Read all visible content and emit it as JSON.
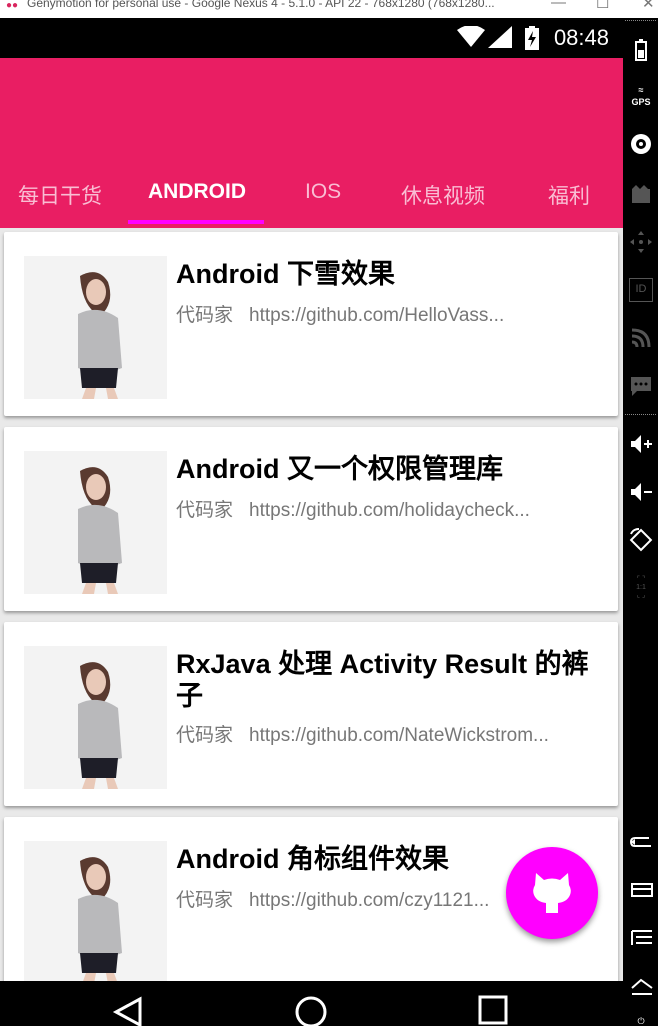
{
  "window": {
    "title": "Genymotion for personal use - Google Nexus 4 - 5.1.0 - API 22 - 768x1280 (768x1280...",
    "minimize": "—",
    "maximize": "☐",
    "close": "✕"
  },
  "status_bar": {
    "time": "08:48"
  },
  "tabs": [
    {
      "label": "每日干货",
      "active": false
    },
    {
      "label": "ANDROID",
      "active": true
    },
    {
      "label": "IOS",
      "active": false
    },
    {
      "label": "休息视频",
      "active": false
    },
    {
      "label": "福利",
      "active": false
    }
  ],
  "articles": [
    {
      "title": "Android 下雪效果",
      "author": "代码家",
      "url": "https://github.com/HelloVass..."
    },
    {
      "title": "Android 又一个权限管理库",
      "author": "代码家",
      "url": "https://github.com/holidaycheck..."
    },
    {
      "title": "RxJava 处理 Activity Result 的裤子",
      "author": "代码家",
      "url": "https://github.com/NateWickstrom..."
    },
    {
      "title": "Android 角标组件效果",
      "author": "代码家",
      "url": "https://github.com/czy1121..."
    }
  ],
  "fab": {
    "icon": "github-octocat-icon",
    "color": "#ff00ff"
  },
  "colors": {
    "primary": "#e91e63",
    "accent": "#ff00ff"
  },
  "nav": [
    "back-icon",
    "home-icon",
    "recents-icon"
  ],
  "sidebar_tools": [
    "battery-icon",
    "gps-icon",
    "camera-icon",
    "capture-icon",
    "dpad-icon",
    "id-icon",
    "rss-icon",
    "sms-icon",
    "volume-up-icon",
    "volume-down-icon",
    "rotate-icon",
    "scale-icon",
    "back-icon",
    "home-icon",
    "menu-icon",
    "recents-icon",
    "power-icon"
  ]
}
